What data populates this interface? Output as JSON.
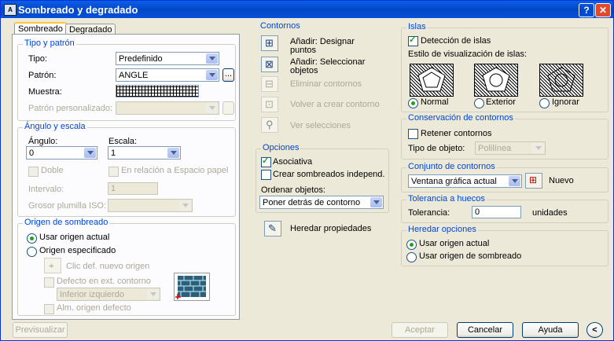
{
  "window": {
    "title": "Sombreado y degradado",
    "help_button": "?",
    "close_button": "✕"
  },
  "tabs": [
    {
      "label": "Sombreado"
    },
    {
      "label": "Degradado"
    }
  ],
  "tipo_patron": {
    "legend": "Tipo y patrón",
    "tipo_label": "Tipo:",
    "tipo_value": "Predefinido",
    "patron_label": "Patrón:",
    "patron_value": "ANGLE",
    "patron_browse": "...",
    "muestra_label": "Muestra:",
    "personalizado_label": "Patrón personalizado:",
    "personalizado_value": ""
  },
  "angulo_escala": {
    "legend": "Ángulo y escala",
    "angulo_label": "Ángulo:",
    "angulo_value": "0",
    "escala_label": "Escala:",
    "escala_value": "1",
    "doble_label": "Doble",
    "relacion_label": "En relación a Espacio papel",
    "intervalo_label": "Intervalo:",
    "intervalo_value": "1",
    "grosor_label": "Grosor plumilla ISO:",
    "grosor_value": ""
  },
  "origen": {
    "legend": "Origen de sombreado",
    "usar_actual": "Usar origen actual",
    "especificado": "Origen especificado",
    "clic_def": "Clic def. nuevo origen",
    "defecto_ext": "Defecto en ext. contorno",
    "posicion_value": "Inferior izquierdo",
    "alm_origen": "Alm. origen defecto"
  },
  "contornos": {
    "legend": "Contornos",
    "anadir_designar": "Añadir: Designar puntos",
    "anadir_seleccionar": "Añadir: Seleccionar objetos",
    "eliminar": "Eliminar contornos",
    "volver_crear": "Volver a crear contorno",
    "ver_selecciones": "Ver selecciones"
  },
  "opciones": {
    "legend": "Opciones",
    "asociativa": "Asociativa",
    "crear_independ": "Crear sombreados independ.",
    "ordenar_label": "Ordenar objetos:",
    "ordenar_value": "Poner detrás de contorno"
  },
  "heredar_label": "Heredar propiedades",
  "islas": {
    "legend": "Islas",
    "deteccion": "Detección de islas",
    "estilo_label": "Estilo de visualización de islas:",
    "normal": "Normal",
    "exterior": "Exterior",
    "ignorar": "Ignorar"
  },
  "conservacion": {
    "legend": "Conservación de contornos",
    "retener": "Retener contornos",
    "tipo_objeto_label": "Tipo de objeto:",
    "tipo_objeto_value": "Polilínea"
  },
  "conjunto": {
    "legend": "Conjunto de contornos",
    "value": "Ventana gráfica actual",
    "nuevo": "Nuevo"
  },
  "tolerancia": {
    "legend": "Tolerancia a huecos",
    "label": "Tolerancia:",
    "value": "0",
    "unidades": "unidades"
  },
  "heredar_opciones": {
    "legend": "Heredar opciones",
    "usar_actual": "Usar origen actual",
    "usar_sombreado": "Usar origen de sombreado"
  },
  "footer": {
    "previsualizar": "Previsualizar",
    "aceptar": "Aceptar",
    "cancelar": "Cancelar",
    "ayuda": "Ayuda",
    "more": "<"
  }
}
